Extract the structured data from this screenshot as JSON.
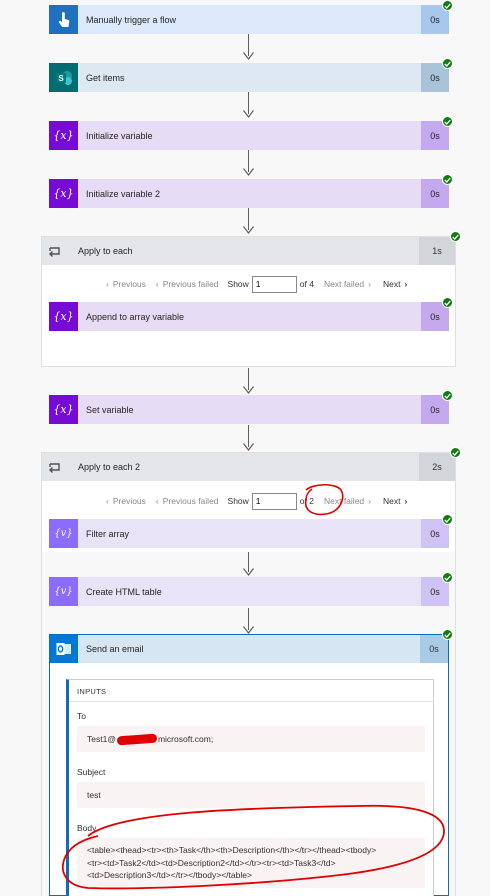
{
  "colors": {
    "trigger": "#dbe9fa",
    "trigger_icon": "#1f70c1",
    "trigger_dur": "#a7c7ec",
    "sharepoint": "#dee8f2",
    "sharepoint_icon": "#036c70",
    "sharepoint_dur": "#a9c4d9",
    "variable": "#e6dcf5",
    "variable_icon": "#770bd6",
    "variable_dur": "#c5a9ef",
    "dataop": "#e9e3f7",
    "dataop_icon": "#8c6cff",
    "dataop_dur": "#cfc2f5",
    "outlook": "#d6e6f3",
    "outlook_icon": "#0078d4",
    "outlook_dur": "#a9cbe6",
    "success": "#107c10",
    "annotation": "#e00000"
  },
  "steps": {
    "trigger": {
      "title": "Manually trigger a flow",
      "duration": "0s",
      "icon": "hand-tap-icon"
    },
    "get_items": {
      "title": "Get items",
      "duration": "0s",
      "icon": "sharepoint-icon"
    },
    "init_var": {
      "title": "Initialize variable",
      "duration": "0s",
      "icon": "variable-icon"
    },
    "init_var2": {
      "title": "Initialize variable 2",
      "duration": "0s",
      "icon": "variable-icon"
    },
    "apply1": {
      "title": "Apply to each",
      "duration": "1s",
      "icon": "loop-icon",
      "pager": {
        "previous": "Previous",
        "previous_failed": "Previous failed",
        "show": "Show",
        "value": "1",
        "of": "of 4",
        "next_failed": "Next failed",
        "next": "Next"
      },
      "inner": {
        "title": "Append to array variable",
        "duration": "0s",
        "icon": "variable-icon"
      }
    },
    "set_var": {
      "title": "Set variable",
      "duration": "0s",
      "icon": "variable-icon"
    },
    "apply2": {
      "title": "Apply to each 2",
      "duration": "2s",
      "icon": "loop-icon",
      "pager": {
        "previous": "Previous",
        "previous_failed": "Previous failed",
        "show": "Show",
        "value": "1",
        "of": "of 2",
        "next_failed": "Next failed",
        "next": "Next"
      }
    },
    "filter": {
      "title": "Filter array",
      "duration": "0s",
      "icon": "data-operation-icon"
    },
    "html_table": {
      "title": "Create HTML table",
      "duration": "0s",
      "icon": "data-operation-icon"
    },
    "email": {
      "title": "Send an email",
      "duration": "0s",
      "icon": "outlook-icon",
      "inputs_label": "INPUTS",
      "to_label": "To",
      "to_prefix": "Test1@",
      "to_suffix": "microsoft.com;",
      "subject_label": "Subject",
      "subject_value": "test",
      "body_label": "Body",
      "body_line1": "<table><thead><tr><th>Task</th><th>Description</th></tr></thead><tbody>",
      "body_line2": "<tr><td>Task2</td><td>Description2</td></tr><tr><td>Task3</td>",
      "body_line3": "<td>Description3</td></tr></tbody></table>"
    }
  }
}
